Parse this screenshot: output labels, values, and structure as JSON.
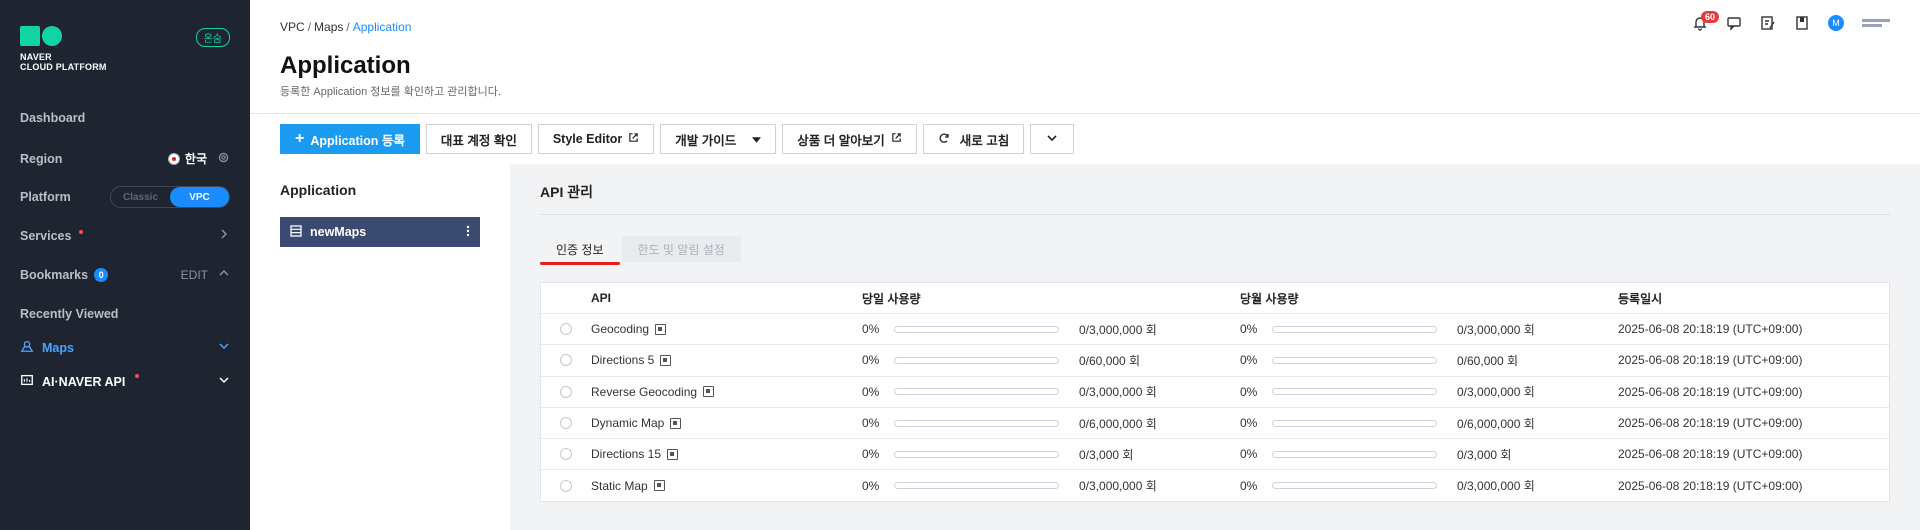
{
  "sidebar": {
    "logo_line1": "NAVER",
    "logo_line2": "CLOUD PLATFORM",
    "online_badge": "온숨",
    "dashboard": "Dashboard",
    "region_label": "Region",
    "region_value": "한국",
    "platform_label": "Platform",
    "platform_classic": "Classic",
    "platform_vpc": "VPC",
    "services_label": "Services",
    "bookmarks_label": "Bookmarks",
    "bookmarks_count": "0",
    "bookmarks_edit": "EDIT",
    "recently_viewed": "Recently Viewed",
    "recent_items": [
      "Maps",
      "AI·NAVER API"
    ],
    "accent_color": "#1a8cff",
    "brand_color": "#12d3a5"
  },
  "header": {
    "breadcrumb": [
      "VPC",
      "Maps",
      "Application"
    ],
    "title": "Application",
    "description": "등록한 Application 정보를 확인하고 관리합니다.",
    "notification_count": "60",
    "avatar_initial": "M"
  },
  "toolbar": {
    "register": "Application 등록",
    "confirm_account": "대표 계정 확인",
    "style_editor": "Style Editor",
    "dev_guide": "개발 가이드",
    "more_product": "상품 더 알아보기",
    "refresh": "새로 고침"
  },
  "app_panel": {
    "title": "Application",
    "selected_app": "newMaps"
  },
  "api_section": {
    "title": "API 관리",
    "tabs": [
      "인증 정보",
      "한도 및 알림 설정"
    ],
    "columns": [
      "API",
      "당일 사용량",
      "당월 사용량",
      "등록일시"
    ],
    "rows": [
      {
        "api": "Geocoding",
        "day_pct": "0%",
        "day_quota": "0/3,000,000 회",
        "day_fill": 0,
        "month_pct": "0%",
        "month_quota": "0/3,000,000 회",
        "month_fill": 0,
        "date": "2025-06-08 20:18:19 (UTC+09:00)"
      },
      {
        "api": "Directions 5",
        "day_pct": "0%",
        "day_quota": "0/60,000 회",
        "day_fill": 0,
        "month_pct": "0%",
        "month_quota": "0/60,000 회",
        "month_fill": 0,
        "date": "2025-06-08 20:18:19 (UTC+09:00)"
      },
      {
        "api": "Reverse Geocoding",
        "day_pct": "0%",
        "day_quota": "0/3,000,000 회",
        "day_fill": 0,
        "month_pct": "0%",
        "month_quota": "0/3,000,000 회",
        "month_fill": 0,
        "date": "2025-06-08 20:18:19 (UTC+09:00)"
      },
      {
        "api": "Dynamic Map",
        "day_pct": "0%",
        "day_quota": "0/6,000,000 회",
        "day_fill": 0,
        "month_pct": "0%",
        "month_quota": "0/6,000,000 회",
        "month_fill": 0,
        "date": "2025-06-08 20:18:19 (UTC+09:00)"
      },
      {
        "api": "Directions 15",
        "day_pct": "0%",
        "day_quota": "0/3,000 회",
        "day_fill": 0,
        "month_pct": "0%",
        "month_quota": "0/3,000 회",
        "month_fill": 0,
        "date": "2025-06-08 20:18:19 (UTC+09:00)"
      },
      {
        "api": "Static Map",
        "day_pct": "0%",
        "day_quota": "0/3,000,000 회",
        "day_fill": 0,
        "month_pct": "0%",
        "month_quota": "0/3,000,000 회",
        "month_fill": 0,
        "date": "2025-06-08 20:18:19 (UTC+09:00)"
      }
    ]
  }
}
